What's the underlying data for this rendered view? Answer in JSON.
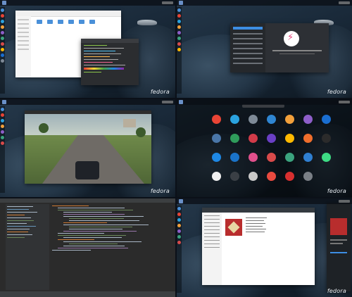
{
  "brand": "fedora",
  "colors": {
    "accent": "#3d8ee3",
    "fedora_blue": "#294172",
    "game_road": "#6f6b66"
  },
  "tiles": [
    {
      "name": "files-terminal-desktop"
    },
    {
      "name": "about-settings-desktop"
    },
    {
      "name": "game-desktop"
    },
    {
      "name": "app-grid-desktop"
    },
    {
      "name": "ide-desktop"
    },
    {
      "name": "music-player-desktop"
    }
  ],
  "launcher": {
    "apps": [
      {
        "icon": "chrome-icon",
        "color": "#e94435"
      },
      {
        "icon": "telegram-icon",
        "color": "#2aa3e0"
      },
      {
        "icon": "tweaks-icon",
        "color": "#7e8a97"
      },
      {
        "icon": "mail-icon",
        "color": "#2f86d2"
      },
      {
        "icon": "package-icon",
        "color": "#f2a03b"
      },
      {
        "icon": "hex-icon",
        "color": "#8e5ec9"
      },
      {
        "icon": "trello-icon",
        "color": "#1a6ed1"
      },
      {
        "icon": "vk-icon",
        "color": "#4a76a8"
      },
      {
        "icon": "calculator-icon",
        "color": "#2f9c5b"
      },
      {
        "icon": "usb-icon",
        "color": "#d13b49"
      },
      {
        "icon": "gamepad-icon",
        "color": "#6a3fc4"
      },
      {
        "icon": "play-icon",
        "color": "#ffb900"
      },
      {
        "icon": "folder-icon",
        "color": "#f06e2c"
      },
      {
        "icon": "ghost-icon",
        "color": "#2b2b2b"
      },
      {
        "icon": "drop-icon",
        "color": "#1e88e5"
      },
      {
        "icon": "virtualbox-icon",
        "color": "#1a73c8"
      },
      {
        "icon": "palette-icon",
        "color": "#e0508c"
      },
      {
        "icon": "music-icon",
        "color": "#d84a4a"
      },
      {
        "icon": "disk-icon",
        "color": "#3ba37e"
      },
      {
        "icon": "globe-icon",
        "color": "#2f7fd1"
      },
      {
        "icon": "android-icon",
        "color": "#3ddc84"
      },
      {
        "icon": "clock-icon",
        "color": "#f0f0f0"
      },
      {
        "icon": "settings-icon",
        "color": "#3a3f45"
      },
      {
        "icon": "pen-icon",
        "color": "#c9c9c9"
      },
      {
        "icon": "lifebuoy-icon",
        "color": "#e94a3f"
      },
      {
        "icon": "pdf-icon",
        "color": "#d82f2f"
      },
      {
        "icon": "tools-icon",
        "color": "#7a7f86"
      }
    ]
  }
}
